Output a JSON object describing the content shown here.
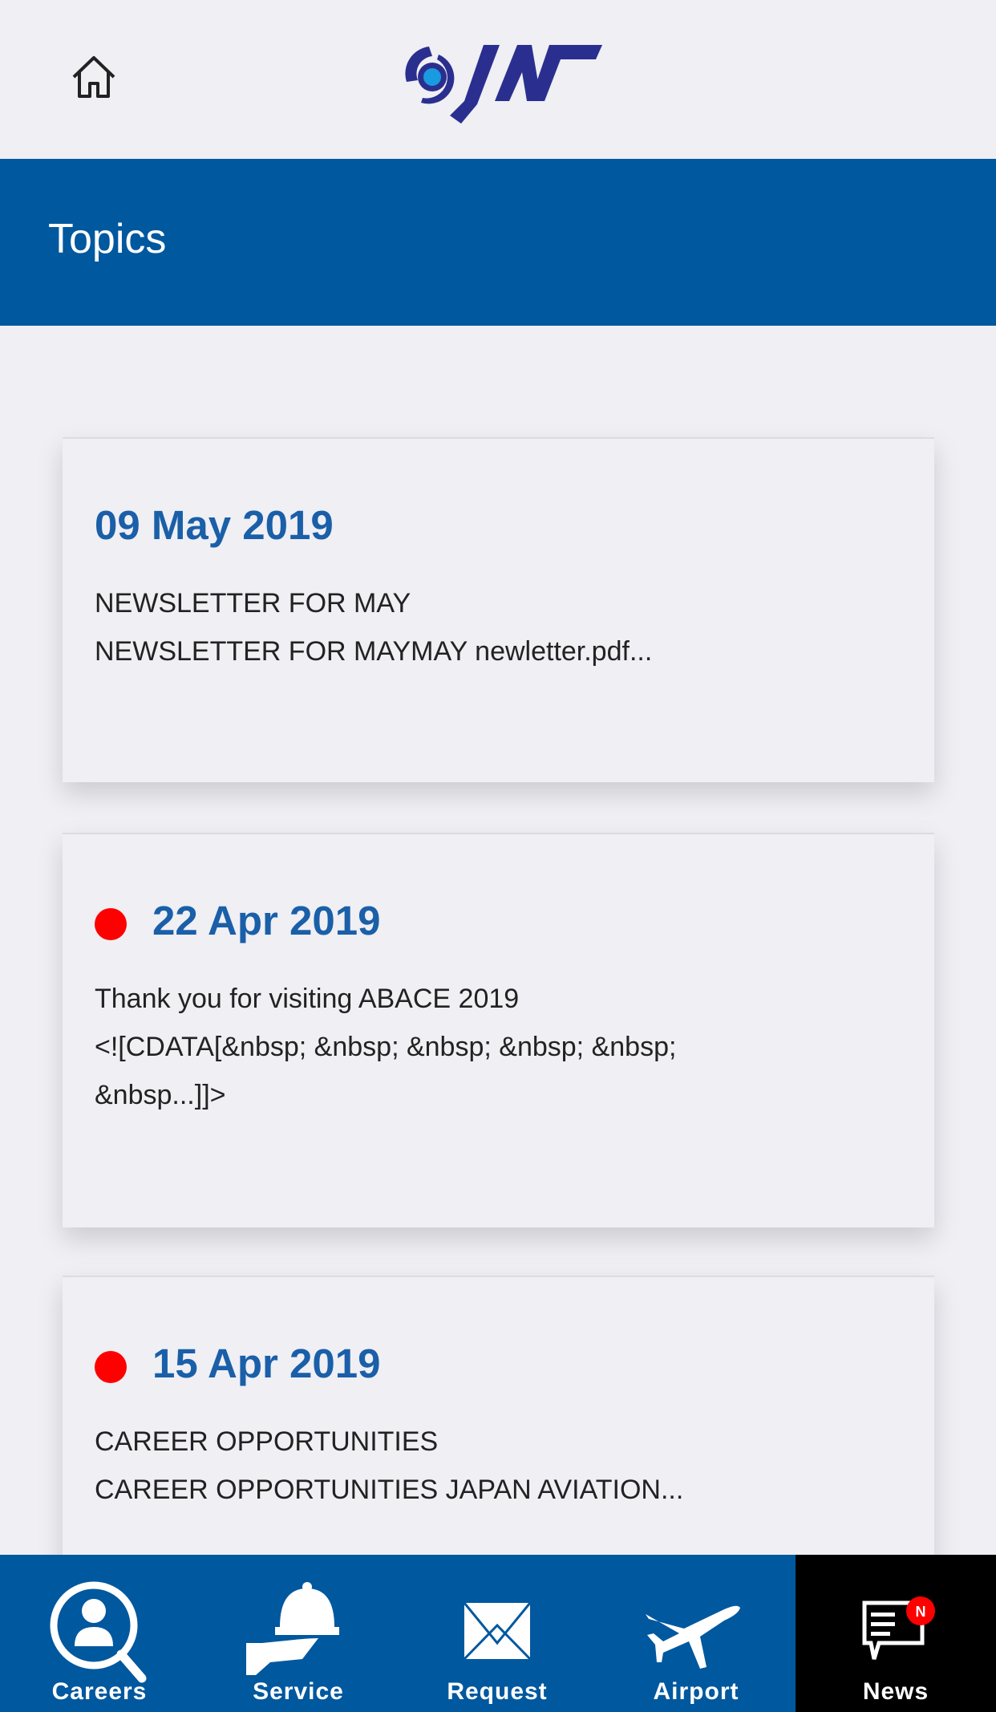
{
  "header": {
    "home_icon": "home-icon",
    "logo_text": "JAS"
  },
  "page_title": "Topics",
  "topics": [
    {
      "date": "09 May 2019",
      "unread": false,
      "text": "NEWSLETTER FOR MAY\nNEWSLETTER FOR MAYMAY newletter.pdf..."
    },
    {
      "date": "22 Apr 2019",
      "unread": true,
      "text": "Thank you for visiting ABACE 2019\n<![CDATA[&nbsp; &nbsp; &nbsp; &nbsp; &nbsp;\n&nbsp...]]>"
    },
    {
      "date": "15 Apr 2019",
      "unread": true,
      "text": "CAREER OPPORTUNITIES\nCAREER OPPORTUNITIES JAPAN AVIATION..."
    }
  ],
  "nav": [
    {
      "label": "Careers",
      "icon": "careers-search-person-icon"
    },
    {
      "label": "Service",
      "icon": "service-cloche-icon"
    },
    {
      "label": "Request",
      "icon": "envelope-icon"
    },
    {
      "label": "Airport",
      "icon": "airplane-icon"
    },
    {
      "label": "News",
      "icon": "news-chat-icon",
      "badge": "N",
      "active": true
    }
  ],
  "colors": {
    "brand_blue": "#00589f",
    "date_blue": "#1a5fa8",
    "unread_dot": "#ff0000",
    "logo_navy": "#2a2f8f"
  }
}
